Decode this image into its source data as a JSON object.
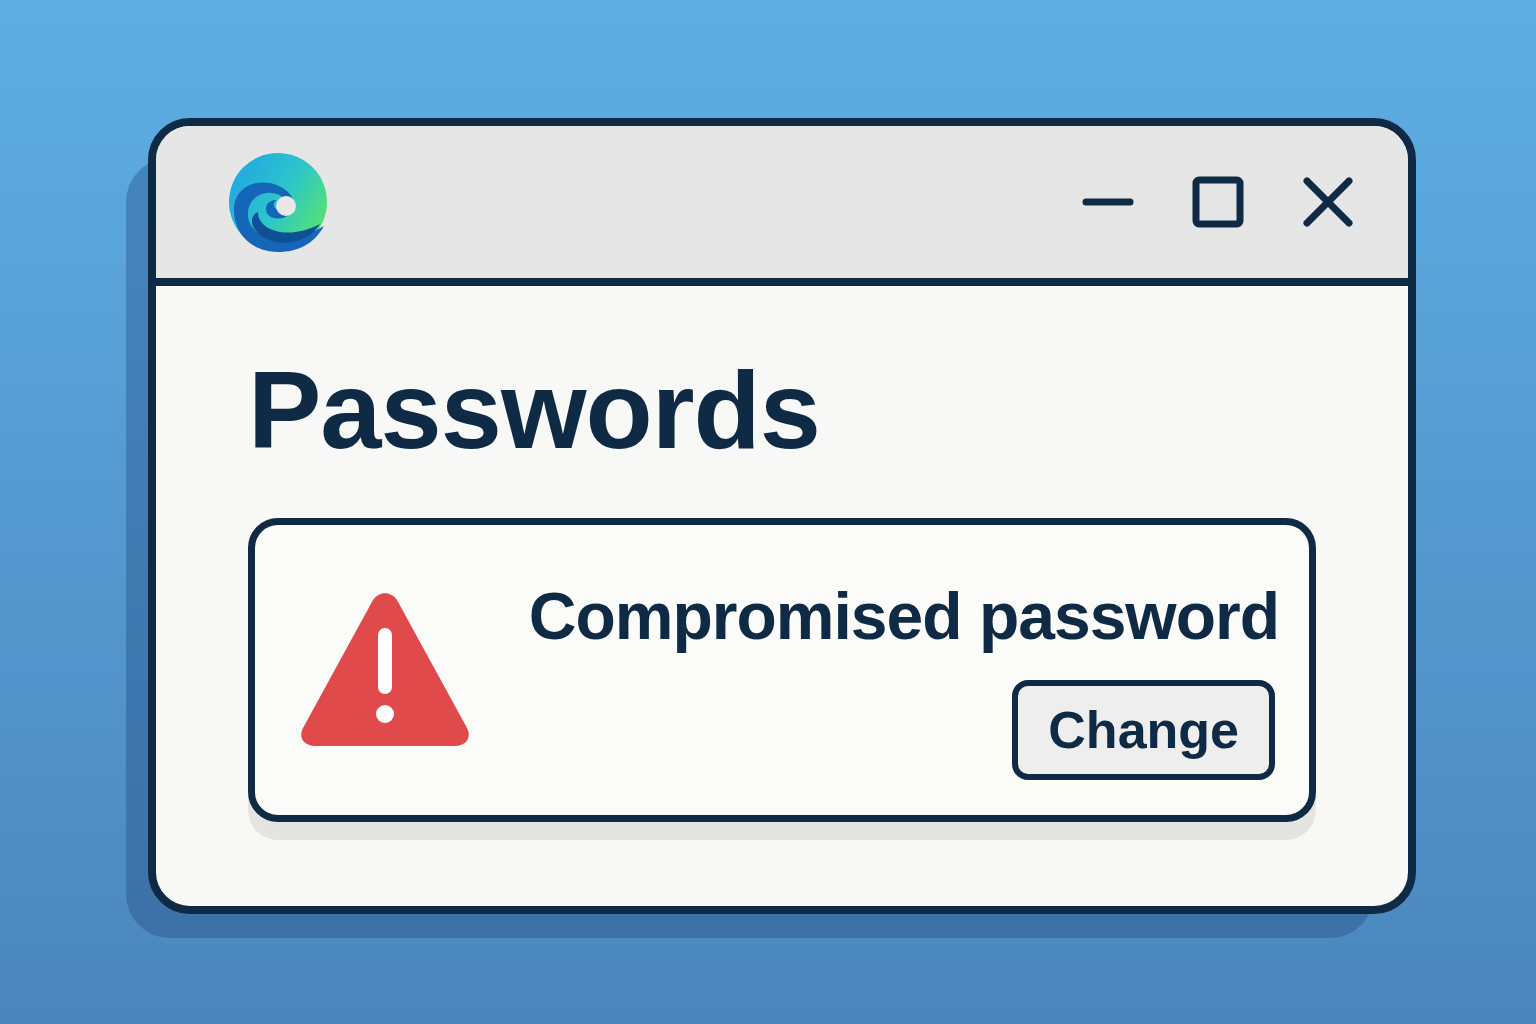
{
  "page": {
    "title": "Passwords"
  },
  "alert": {
    "message": "Compromised password",
    "button": "Change"
  }
}
